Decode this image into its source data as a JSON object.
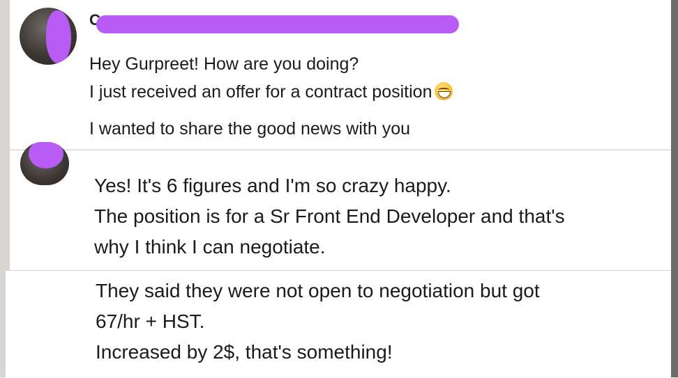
{
  "conversation": {
    "message_group_1": {
      "sender_initial": "C",
      "lines": [
        "Hey Gurpreet! How are you doing?",
        "I just received an offer for a contract position"
      ],
      "emoji": "grinning-face-emoji",
      "line_3": "I wanted to share the good news with you"
    },
    "message_group_2": {
      "lines": [
        "Yes! It's 6 figures and I'm so crazy happy.",
        "The position is for a Sr Front End Developer and that's",
        "why I think I can negotiate."
      ]
    },
    "message_group_3": {
      "lines": [
        "They said they were not open to negotiation but got",
        "67/hr + HST.",
        "Increased by 2$, that's something!"
      ]
    }
  },
  "colors": {
    "redaction": "#b85cf5",
    "panel_background": "#ffffff",
    "text": "#1b1b1b"
  }
}
